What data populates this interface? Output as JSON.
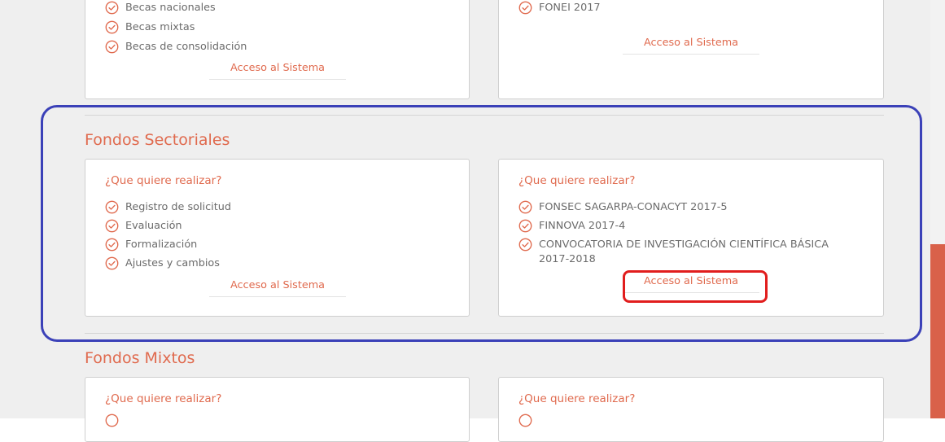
{
  "colors": {
    "accent": "#e06a4e",
    "annotation_blue": "#3b41b8",
    "annotation_red": "#e11d1d",
    "scroll_thumb": "#d9614a"
  },
  "top_section": {
    "left_card": {
      "items": [
        "Becas nacionales",
        "Becas mixtas",
        "Becas de consolidación"
      ],
      "access": "Acceso al Sistema"
    },
    "right_card": {
      "items": [
        "FONEI 2017"
      ],
      "access": "Acceso al Sistema"
    }
  },
  "fondos_sectoriales": {
    "title": "Fondos Sectoriales",
    "left_card": {
      "title": "¿Que quiere realizar?",
      "items": [
        "Registro de solicitud",
        "Evaluación",
        "Formalización",
        "Ajustes y cambios"
      ],
      "access": "Acceso al Sistema"
    },
    "right_card": {
      "title": "¿Que quiere realizar?",
      "items": [
        "FONSEC SAGARPA-CONACYT 2017-5",
        "FINNOVA 2017-4",
        "CONVOCATORIA DE INVESTIGACIÓN CIENTÍFICA BÁSICA 2017-2018"
      ],
      "access": "Acceso al Sistema"
    }
  },
  "fondos_mixtos": {
    "title": "Fondos Mixtos",
    "left_card": {
      "title": "¿Que quiere realizar?"
    },
    "right_card": {
      "title": "¿Que quiere realizar?"
    }
  },
  "icons": {
    "check": "check-circle-icon"
  }
}
